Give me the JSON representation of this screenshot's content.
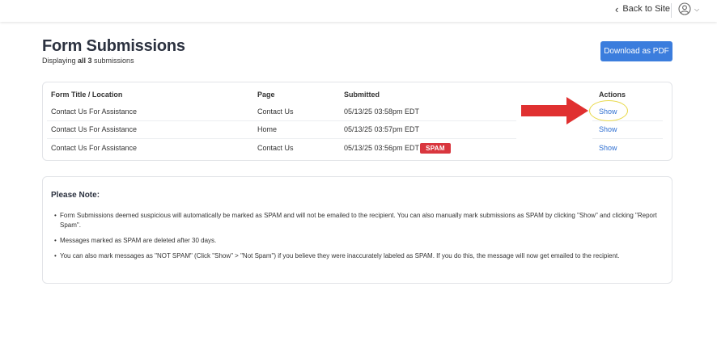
{
  "topbar": {
    "back_label": "Back to Site",
    "avatar_icon": "user-circle-icon",
    "caret_icon": "chevron-down-icon"
  },
  "header": {
    "title": "Form Submissions",
    "subtitle_prefix": "Displaying ",
    "subtitle_bold": "all 3",
    "subtitle_suffix": " submissions",
    "download_label": "Download as PDF"
  },
  "table": {
    "headers": {
      "form": "Form Title / Location",
      "page": "Page",
      "submitted": "Submitted",
      "actions": "Actions"
    },
    "rows": [
      {
        "form": "Contact Us For Assistance",
        "page": "Contact Us",
        "submitted": "05/13/25 03:58pm EDT",
        "action": "Show"
      },
      {
        "form": "Contact Us For Assistance",
        "page": "Home",
        "submitted": "05/13/25 03:57pm EDT",
        "action": "Show"
      },
      {
        "form": "Contact Us For Assistance",
        "page": "Contact Us",
        "submitted": "05/13/25 03:56pm EDT",
        "action": "Show",
        "badge": "SPAM"
      }
    ]
  },
  "note": {
    "title": "Please Note:",
    "bullets": [
      "Form Submissions deemed suspicious will automatically be marked as SPAM and will not be emailed to the recipient. You can also manually mark submissions as SPAM by clicking \"Show\" and clicking \"Report Spam\".",
      "Messages marked as SPAM are deleted after 30 days.",
      "You can also mark messages as \"NOT SPAM\" (Click \"Show\" > \"Not Spam\") if you believe they were inaccurately labeled as SPAM. If you do this, the message will now get emailed to the recipient."
    ]
  },
  "colors": {
    "accent": "#3b7ddd",
    "link": "#2f6fd1",
    "spam": "#d9363e",
    "arrow": "#e03030",
    "highlight": "#e8d94a"
  }
}
